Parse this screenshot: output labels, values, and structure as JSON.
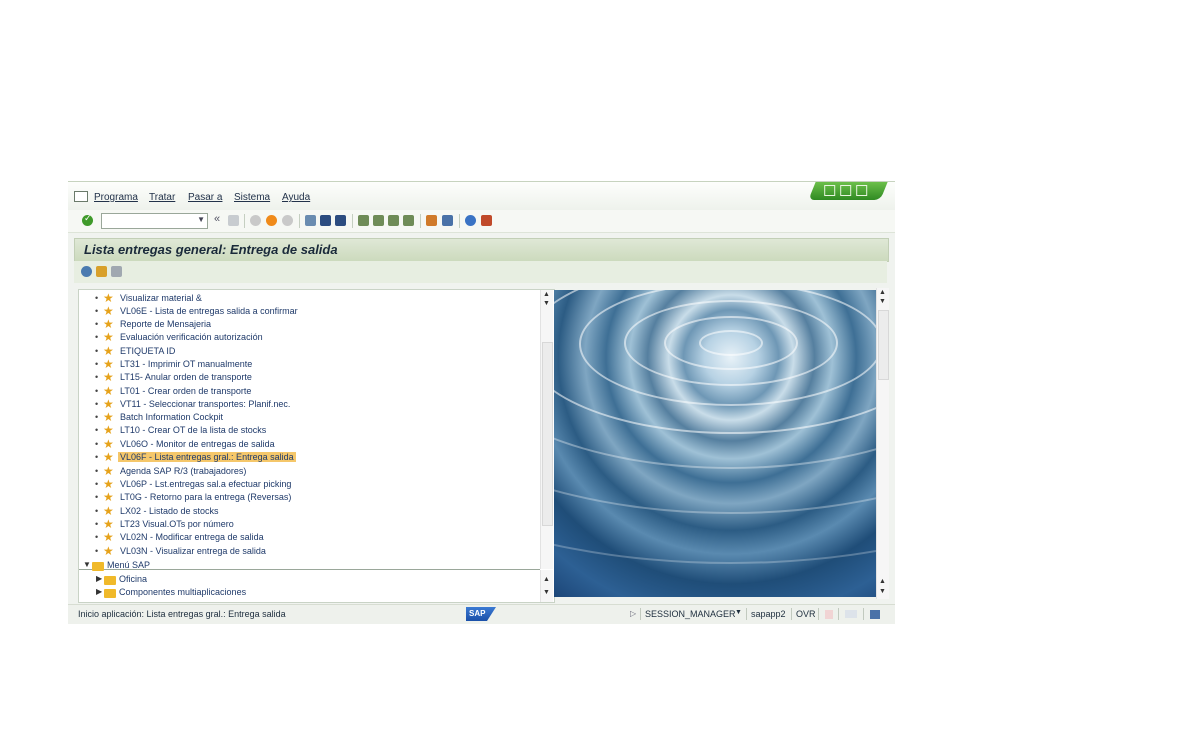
{
  "menubar": {
    "items": [
      "Programa",
      "Tratar",
      "Pasar a",
      "Sistema",
      "Ayuda"
    ]
  },
  "toolbar": {
    "command_field_value": "",
    "icons": [
      "enter-icon",
      "save-icon",
      "back-icon",
      "exit-icon",
      "cancel-icon",
      "print-icon",
      "find-icon",
      "find-next-icon",
      "first-page-icon",
      "prev-page-icon",
      "next-page-icon",
      "last-page-icon",
      "new-session-icon",
      "shortcut-icon",
      "help-icon",
      "layout-icon"
    ]
  },
  "title": "Lista entregas general: Entrega de salida",
  "tree": {
    "favorites": [
      "Visualizar material &",
      "VL06E - Lista de entregas salida a confirmar",
      "Reporte de Mensajeria",
      "Evaluación verificación autorización",
      "ETIQUETA ID",
      "LT31 - Imprimir OT manualmente",
      "LT15- Anular orden de transporte",
      "LT01 - Crear orden de transporte",
      "VT11 - Seleccionar transportes: Planif.nec.",
      "Batch Information Cockpit",
      "LT10 - Crear OT de la lista de stocks",
      "VL06O - Monitor de entregas de salida",
      "VL06F - Lista entregas gral.: Entrega salida",
      "Agenda SAP R/3 (trabajadores)",
      "VL06P - Lst.entregas sal.a efectuar picking",
      "LT0G - Retorno para la entrega (Reversas)",
      "LX02 - Listado de stocks",
      "LT23 Visual.OTs por número",
      "VL02N - Modificar entrega de salida",
      "VL03N - Visualizar entrega de salida"
    ],
    "selected_index": 12,
    "sap_menu_label": "Menú SAP",
    "sap_menu_children": [
      "Oficina",
      "Componentes multiaplicaciones"
    ]
  },
  "status": {
    "message": "Inicio aplicación: Lista entregas gral.: Entrega salida",
    "sap_logo": "SAP",
    "session": "SESSION_MANAGER",
    "server": "sapapp2",
    "mode": "OVR"
  }
}
